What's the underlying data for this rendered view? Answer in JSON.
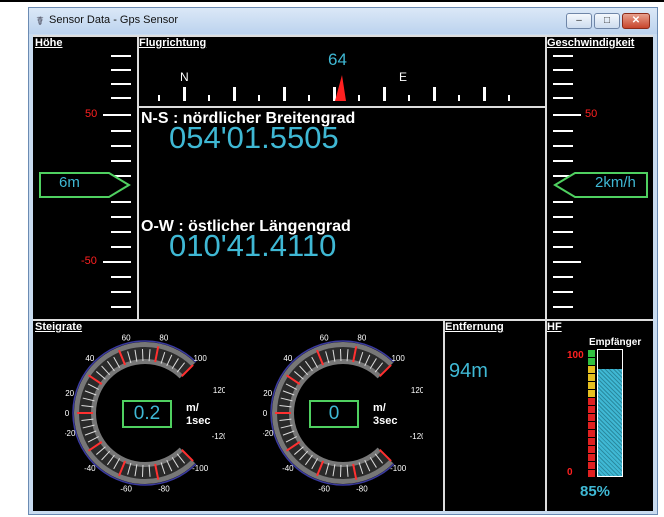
{
  "window": {
    "title": "Sensor Data - Gps Sensor",
    "controls": {
      "minimize": "–",
      "maximize": "□",
      "close": "✕"
    }
  },
  "headers": {
    "altitude": "Höhe",
    "heading": "Flugrichtung",
    "speed": "Geschwindigkeit",
    "climb": "Steigrate",
    "distance": "Entfernung",
    "rf": "HF"
  },
  "altitude": {
    "value": "6m",
    "scale_labels": [
      "50",
      "-50"
    ]
  },
  "speed": {
    "value": "2km/h",
    "scale_label": "50"
  },
  "heading": {
    "value": "64",
    "compass": [
      "N",
      "E"
    ]
  },
  "position": {
    "lat_label": "N-S : nördlicher Breitengrad",
    "lat_value": "054'01.5505",
    "lon_label": "O-W : östlicher Längengrad",
    "lon_value": "010'41.4110"
  },
  "climb_gauges": [
    {
      "value": "0.2",
      "unit_line1": "m/",
      "unit_line2": "1sec"
    },
    {
      "value": "0",
      "unit_line1": "m/",
      "unit_line2": "3sec"
    }
  ],
  "gauge_scale": {
    "labels": [
      "60",
      "80",
      "40",
      "100",
      "20",
      "120",
      "0",
      "-20",
      "-120",
      "-40",
      "-100",
      "-60",
      "-80"
    ]
  },
  "distance": {
    "value": "94m"
  },
  "rf": {
    "receiver_label": "Empfänger",
    "scale_top": "100",
    "scale_bottom": "0",
    "percent": "85%",
    "level": 0.85
  },
  "colors": {
    "accent": "#3fb8d4",
    "marker": "#4fd060",
    "scale_red": "#ff2020"
  }
}
